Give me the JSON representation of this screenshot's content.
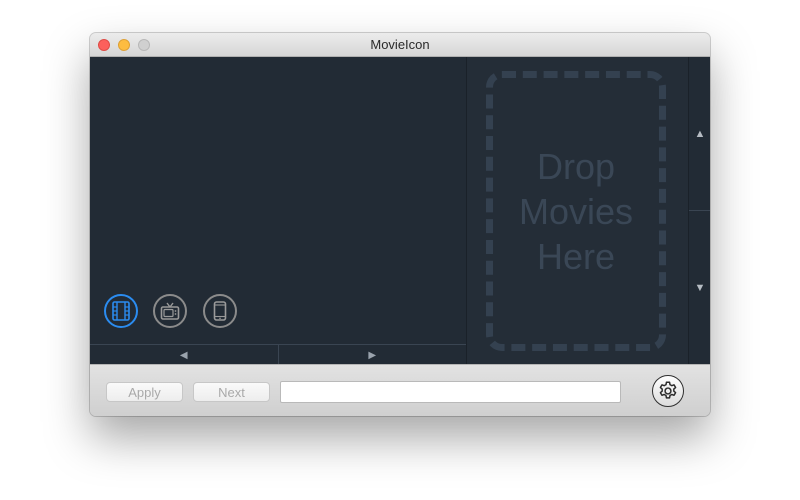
{
  "window": {
    "title": "MovieIcon"
  },
  "modes": [
    {
      "icon": "film-icon",
      "selected": true
    },
    {
      "icon": "tv-icon",
      "selected": false
    },
    {
      "icon": "phone-icon",
      "selected": false
    }
  ],
  "navigation": {
    "prev_glyph": "◀",
    "next_glyph": "▶"
  },
  "drop_zone": {
    "line1": "Drop",
    "line2": "Movies",
    "line3": "Here"
  },
  "scroll": {
    "up_glyph": "▲",
    "down_glyph": "▼"
  },
  "footer": {
    "apply_label": "Apply",
    "next_label": "Next",
    "input_value": "",
    "input_placeholder": ""
  },
  "colors": {
    "accent": "#2b8cf0",
    "content_bg": "#222b35",
    "drop_text": "#3a4756"
  }
}
